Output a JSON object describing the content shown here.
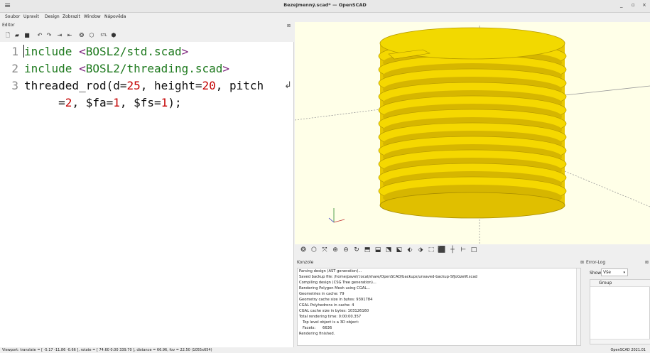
{
  "window": {
    "app_menu_icon": "hamburger-icon",
    "title": "Bezejmenný.scad* — OpenSCAD",
    "minimize": "_",
    "maximize": "▫",
    "close": "×"
  },
  "menubar": {
    "items": [
      "Soubor",
      "Upravit",
      "Design",
      "Zobrazit",
      "Window",
      "Nápověda"
    ]
  },
  "editor": {
    "label": "Editor",
    "close": "⊠",
    "toolbar": [
      "new-file-icon",
      "open-file-icon",
      "save-icon",
      "undo-icon",
      "redo-icon",
      "indent-icon",
      "unindent-icon",
      "preview-icon",
      "render-icon",
      "export-stl-icon",
      "export-3d-icon"
    ],
    "toolbar_text": {
      "stl": "STL"
    },
    "lines": [
      {
        "num": "1",
        "parts": [
          [
            "kw",
            "include"
          ],
          [
            "plain",
            " "
          ],
          [
            "ang",
            "<"
          ],
          [
            "path",
            "BOSL2/std.scad"
          ],
          [
            "ang",
            ">"
          ]
        ]
      },
      {
        "num": "2",
        "parts": [
          [
            "kw",
            "include"
          ],
          [
            "plain",
            " "
          ],
          [
            "ang",
            "<"
          ],
          [
            "path",
            "BOSL2/threading.scad"
          ],
          [
            "ang",
            ">"
          ]
        ]
      },
      {
        "num": "3",
        "parts": [
          [
            "plain",
            "threaded_rod(d="
          ],
          [
            "num",
            "25"
          ],
          [
            "plain",
            ", height="
          ],
          [
            "num",
            "20"
          ],
          [
            "plain",
            ", pitch"
          ]
        ]
      },
      {
        "num": "",
        "parts": [
          [
            "plain",
            "     ="
          ],
          [
            "num",
            "2"
          ],
          [
            "plain",
            ", $fa="
          ],
          [
            "num",
            "1"
          ],
          [
            "plain",
            ", $fs="
          ],
          [
            "num",
            "1"
          ],
          [
            "plain",
            ");"
          ]
        ]
      }
    ]
  },
  "view_toolbar": [
    "preview-icon",
    "render-icon",
    "view-all-icon",
    "zoom-in-icon",
    "zoom-out-icon",
    "reset-view-icon",
    "view-right-icon",
    "view-top-icon",
    "view-bottom-icon",
    "view-left-icon",
    "view-front-icon",
    "view-back-icon",
    "perspective-icon",
    "orthogonal-icon",
    "show-axes-icon",
    "show-scale-icon",
    "show-edges-icon"
  ],
  "console": {
    "label": "Konzole",
    "close": "⊠",
    "lines": [
      "Parsing design (AST generation)...",
      "Saved backup file: /home/pavel/.local/share/OpenSCAD/backups/unsaved-backup-SfJoGzeW.scad",
      "Compiling design (CSG Tree generation)...",
      "Rendering Polygon Mesh using CGAL...",
      "Geometries in cache: 79",
      "Geometry cache size in bytes: 9391784",
      "CGAL Polyhedrons in cache: 4",
      "CGAL cache size in bytes: 103126160",
      "Total rendering time: 0:00:00.357",
      "   Top level object is a 3D object:",
      "   Facets:      6636",
      "Rendering finished."
    ]
  },
  "error_log": {
    "label": "Error-Log",
    "close": "⊠",
    "show_label": "Show",
    "show_value": "Vše",
    "column_group": "Group"
  },
  "status": {
    "viewport": "Viewport: translate = [ -5.17 -11.86 -0.66 ], rotate = [ 74.60 0.00 339.70 ], distance = 66.96, fov = 22.50 (1055x654)",
    "version": "OpenSCAD 2021.01"
  },
  "colors": {
    "viewport_bg": "#ffffe8",
    "model_fill": "#f5d800",
    "model_shadow": "#c8a800",
    "keyword": "#1f7a1f",
    "number": "#c40000"
  }
}
